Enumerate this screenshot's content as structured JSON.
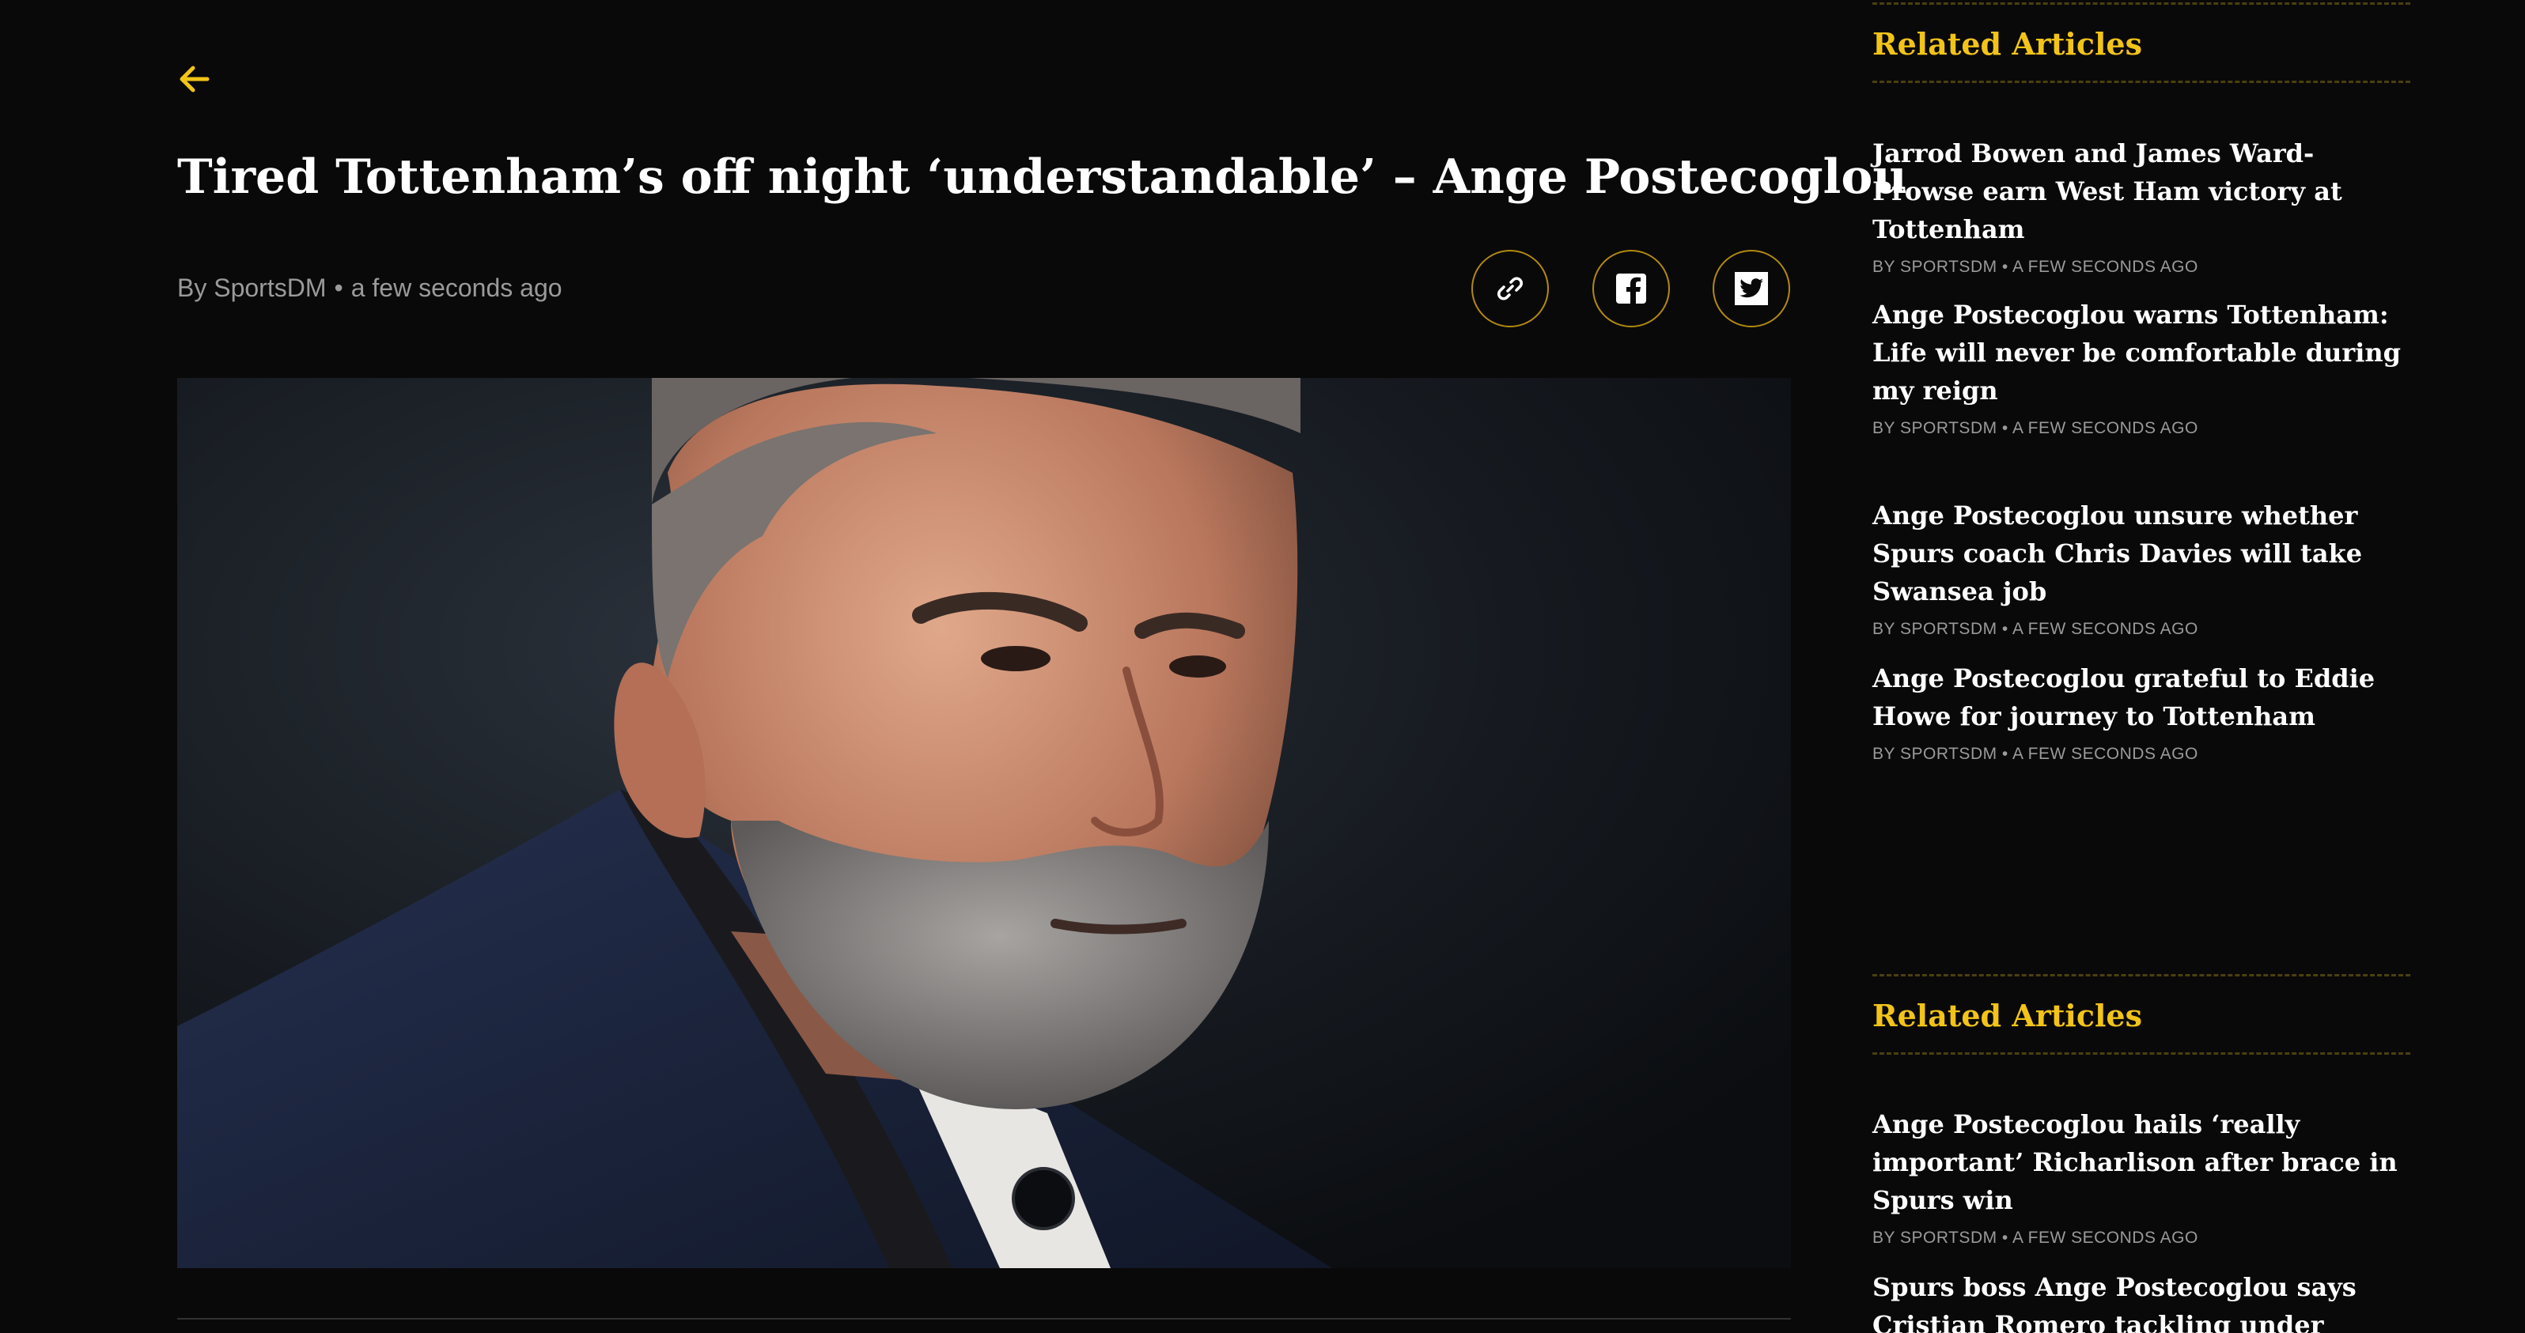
{
  "article": {
    "headline": "Tired Tottenham’s off night ‘understandable’ – Ange Postecoglou",
    "author": "By SportsDM",
    "separator": "•",
    "timestamp": "a few seconds ago"
  },
  "icons": {
    "back": "arrow-left-icon",
    "link": "link-icon",
    "facebook": "facebook-icon",
    "twitter": "twitter-icon"
  },
  "colors": {
    "background": "#0a0909",
    "accent": "#f2c418",
    "share_border": "#b08a10",
    "meta_text": "#9a9a9a"
  },
  "sidebar": {
    "sections": [
      {
        "heading": "Related Articles",
        "items": [
          {
            "title": "Jarrod Bowen and James Ward-Prowse earn West Ham victory at Tottenham",
            "meta": "BY SPORTSDM • A FEW SECONDS AGO"
          },
          {
            "title": "Ange Postecoglou warns Tottenham: Life will never be comfortable during my reign",
            "meta": "BY SPORTSDM • A FEW SECONDS AGO"
          },
          {
            "title": "Ange Postecoglou unsure whether Spurs coach Chris Davies will take Swansea job",
            "meta": "BY SPORTSDM • A FEW SECONDS AGO"
          },
          {
            "title": "Ange Postecoglou grateful to Eddie Howe for journey to Tottenham",
            "meta": "BY SPORTSDM • A FEW SECONDS AGO"
          }
        ]
      },
      {
        "heading": "Related Articles",
        "items": [
          {
            "title": "Ange Postecoglou hails ‘really important’ Richarlison after brace in Spurs win",
            "meta": "BY SPORTSDM • A FEW SECONDS AGO"
          },
          {
            "title": "Spurs boss Ange Postecoglou says Cristian Romero tackling under",
            "meta": ""
          }
        ]
      }
    ]
  }
}
